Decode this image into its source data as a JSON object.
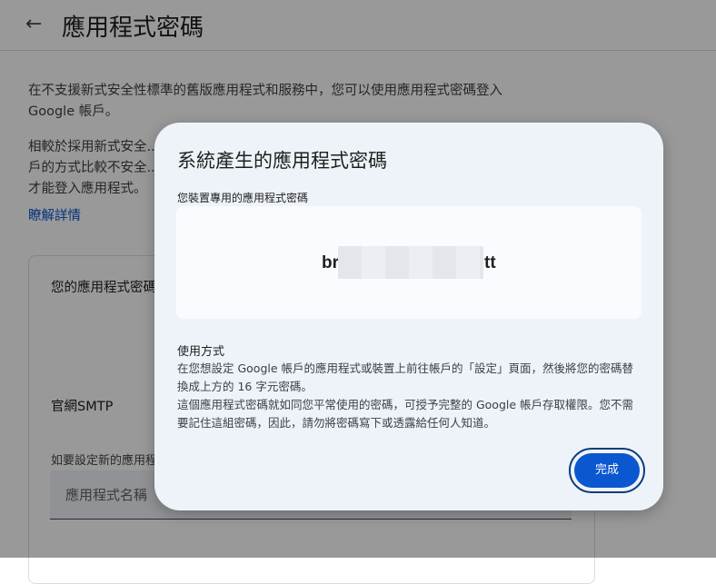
{
  "page": {
    "back_icon": "arrow-left-icon",
    "title": "應用程式密碼",
    "intro_1": "在不支援新式安全性標準的舊版應用程式和服務中，您可以使用應用程式密碼登入 Google 帳戶。",
    "intro_2": "相較於採用新式安全...戶的方式比較不安全...才能登入應用程式。",
    "learn_more": "瞭解詳情",
    "card_title": "您的應用程式密碼",
    "existing_app": "官網SMTP",
    "new_app_hint": "如要設定新的應用程",
    "app_name_placeholder": "應用程式名稱"
  },
  "dialog": {
    "title": "系統產生的應用程式密碼",
    "password_label": "您裝置專用的應用程式密碼",
    "password_visible_start": "br",
    "password_visible_end": "tt",
    "usage_title": "使用方式",
    "usage_line_1": "在您想設定 Google 帳戶的應用程式或裝置上前往帳戶的「設定」頁面，然後將您的密碼替換成上方的 16 字元密碼。",
    "usage_line_2": "這個應用程式密碼就如同您平常使用的密碼，可授予完整的 Google 帳戶存取權限。您不需要記住這組密碼，因此，請勿將密碼寫下或透露給任何人知道。",
    "done_label": "完成"
  },
  "colors": {
    "accent": "#0b57d0",
    "dialog_bg": "#eef3fa",
    "focus_ring": "#0b3d78"
  }
}
